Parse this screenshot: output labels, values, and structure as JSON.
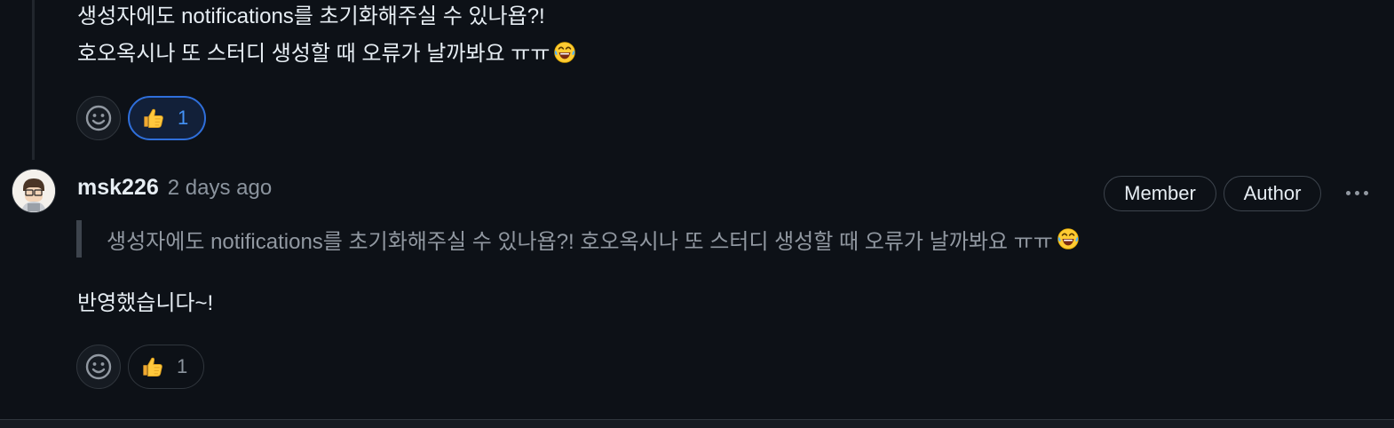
{
  "first_comment": {
    "lines": [
      "생성자에도 notifications를 초기화해주실 수 있나욥?!",
      "호오옥시나 또 스터디 생성할 때 오류가 날까봐요 ㅠㅠ"
    ],
    "trailing_emoji": "face-with-tears-of-joy",
    "reactions": {
      "add_reaction_icon": "smiley-icon",
      "thumbs_up_emoji": "thumbs-up",
      "thumbs_up_count": "1",
      "thumbs_up_selected": true
    }
  },
  "reply": {
    "author": "msk226",
    "timestamp": "2 days ago",
    "badges": [
      "Member",
      "Author"
    ],
    "menu_icon": "kebab-horizontal-icon",
    "quote": "생성자에도 notifications를 초기화해주실 수 있나욥?! 호오옥시나 또 스터디 생성할 때 오류가 날까봐요 ㅠㅠ",
    "quote_trailing_emoji": "face-with-tears-of-joy",
    "body": "반영했습니다~!",
    "reactions": {
      "add_reaction_icon": "smiley-icon",
      "thumbs_up_emoji": "thumbs-up",
      "thumbs_up_count": "1",
      "thumbs_up_selected": false
    }
  },
  "colors": {
    "background": "#0d1117",
    "text": "#e6edf3",
    "muted": "#8b949e",
    "border": "#30363d",
    "accent": "#4493f8",
    "selected_reaction_bg": "#122039"
  }
}
